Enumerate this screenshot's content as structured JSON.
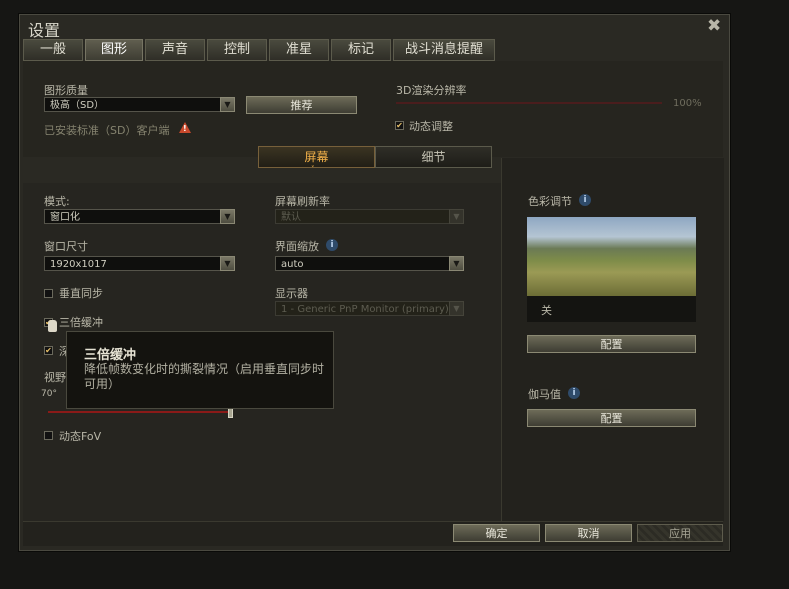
{
  "window": {
    "title": "设置"
  },
  "tabs": [
    {
      "label": "一般"
    },
    {
      "label": "图形"
    },
    {
      "label": "声音"
    },
    {
      "label": "控制"
    },
    {
      "label": "准星"
    },
    {
      "label": "标记"
    },
    {
      "label": "战斗消息提醒"
    }
  ],
  "quality": {
    "label": "图形质量",
    "value": "极高（SD）",
    "recommend_label": "推荐",
    "installed_note": "已安装标准（SD）客户端"
  },
  "render_res": {
    "label": "3D渲染分辨率",
    "percent_text": "100%",
    "level": 1.0,
    "dynamic_label": "动态调整",
    "dynamic_checked": true
  },
  "subtabs": [
    {
      "label": "屏幕"
    },
    {
      "label": "细节"
    }
  ],
  "screen": {
    "mode_label": "模式:",
    "mode_value": "窗口化",
    "size_label": "窗口尺寸",
    "size_value": "1920x1017",
    "vsync_label": "垂直同步",
    "triple_label": "三倍缓冲",
    "refresh_label": "屏幕刷新率",
    "refresh_value": "默认",
    "scale_label": "界面缩放",
    "scale_value": "auto",
    "monitor_label": "显示器",
    "monitor_value": "1 - Generic PnP Monitor (primary)",
    "fov_label_partial": "视野",
    "fov_value": "70°",
    "fov_partial_check_label": "深",
    "dynamic_fov_label": "动态FoV"
  },
  "tooltip": {
    "title": "三倍缓冲",
    "body": "降低帧数变化时的撕裂情况（启用垂直同步时可用）"
  },
  "color": {
    "label": "色彩调节",
    "preview_caption": "关",
    "config_label": "配置"
  },
  "gamma": {
    "label": "伽马值",
    "config_label": "配置"
  },
  "footer": {
    "ok": "确定",
    "cancel": "取消",
    "apply": "应用"
  },
  "colors": {
    "accent": "#f4b24a",
    "warn": "#c8492c",
    "slider": "#8a1a18"
  }
}
